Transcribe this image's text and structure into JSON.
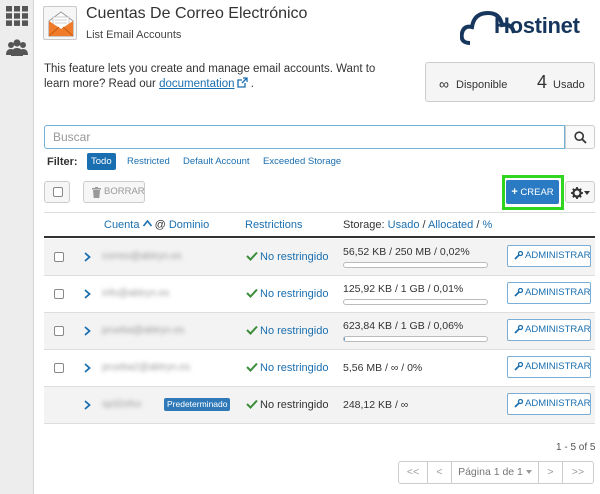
{
  "header": {
    "title": "Cuentas De Correo Electrónico",
    "subtitle": "List Email Accounts",
    "brand": "Hostinet"
  },
  "intro": {
    "text": "This feature lets you create and manage email accounts. Want to learn more? Read our",
    "link_text": "documentation",
    "suffix": "."
  },
  "stats": {
    "available_symbol": "∞",
    "available_label": "Disponible",
    "used_count": "4",
    "used_label": "Usado"
  },
  "search": {
    "placeholder": "Buscar",
    "value": ""
  },
  "filter": {
    "label": "Filter:",
    "options": [
      "Todo",
      "Restricted",
      "Default Account",
      "Exceeded Storage"
    ],
    "active": "Todo"
  },
  "toolbar": {
    "delete_label": "BORRAR",
    "create_label": "CREAR"
  },
  "table": {
    "col_account": "Cuenta",
    "col_domain_sep": "@",
    "col_domain": "Dominio",
    "col_restrictions": "Restrictions",
    "col_storage": "Storage:",
    "col_used": "Usado",
    "col_slash1": "/",
    "col_allocated": "Allocated",
    "col_slash2": "/",
    "col_percent": "%",
    "rows": [
      {
        "account": "correo@abtryn.es",
        "restriction": "No restringido",
        "usage": "56,52 KB / 250 MB / 0,02%",
        "fill_pct": 0.02,
        "action": "ADMINISTRAR"
      },
      {
        "account": "info@abtryn.es",
        "restriction": "No restringido",
        "usage": "125,92 KB / 1 GB / 0,01%",
        "fill_pct": 0.01,
        "action": "ADMINISTRAR"
      },
      {
        "account": "prueba@abtryn.es",
        "restriction": "No restringido",
        "usage": "623,84 KB / 1 GB / 0,06%",
        "fill_pct": 0.06,
        "action": "ADMINISTRAR"
      },
      {
        "account": "prueba2@abtryn.es",
        "restriction": "No restringido",
        "usage": "5,56 MB / ∞ / 0%",
        "fill_pct": 0,
        "action": "ADMINISTRAR"
      },
      {
        "account": "sp32xfxx",
        "badge": "Predeterminado",
        "restriction": "No restringido",
        "usage": "248,12 KB / ∞",
        "fill_pct": null,
        "action": "ADMINISTRAR"
      }
    ]
  },
  "pagination": {
    "count": "1 - 5 of 5",
    "first": "<<",
    "prev": "<",
    "page_label": "Página 1 de 1",
    "next": ">",
    "last": ">>"
  },
  "colors": {
    "link": "#1a6fb0",
    "primary_button": "#2b7bc4",
    "highlight_frame": "#2fd51f",
    "brand": "#17365d",
    "check": "#3c8d3c"
  }
}
